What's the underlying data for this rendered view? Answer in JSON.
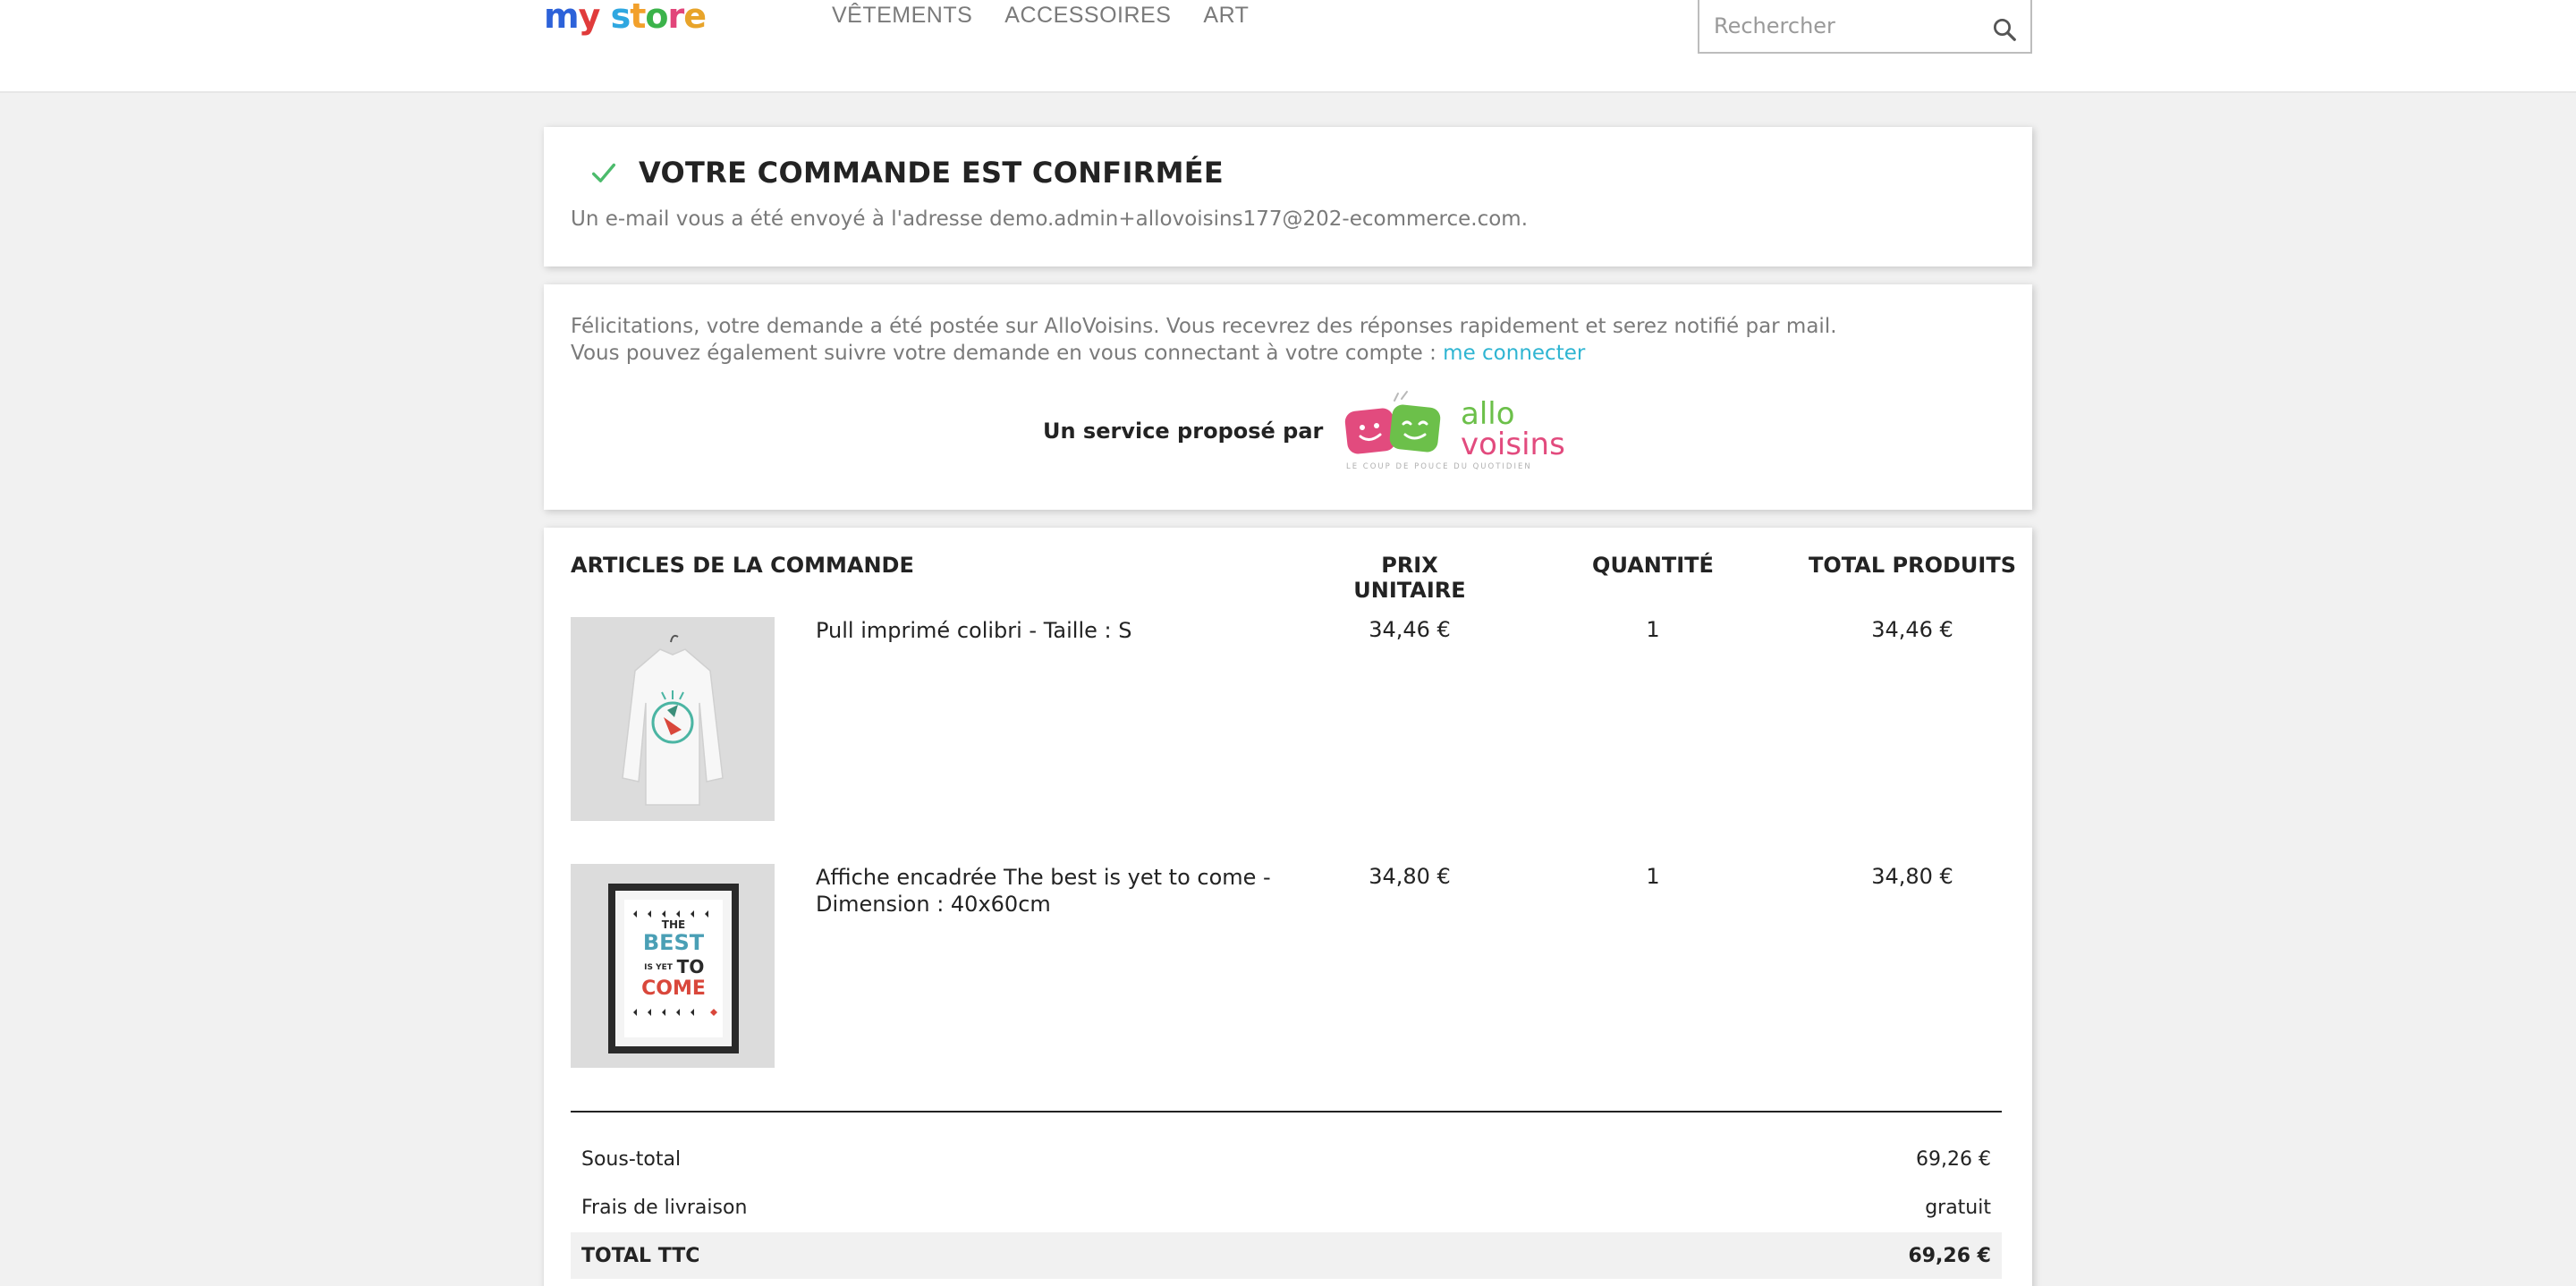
{
  "header": {
    "logo": [
      "m",
      "y",
      " ",
      "s",
      "t",
      "o",
      "r",
      "e"
    ],
    "logo_colors": [
      "#2d62d9",
      "#e03b3b",
      "#ffffff",
      "#2fa7e0",
      "#f2a02b",
      "#3bb34a",
      "#e2457a",
      "#e8a42a"
    ],
    "nav": [
      "VÊTEMENTS",
      "ACCESSOIRES",
      "ART"
    ],
    "search_placeholder": "Rechercher"
  },
  "confirmation": {
    "title": "VOTRE COMMANDE EST CONFIRMÉE",
    "mail_text": "Un e-mail vous a été envoyé à l'adresse demo.admin+allovoisins177@202-ecommerce.com.",
    "check_color": "#4cbb6c"
  },
  "allovoisins": {
    "line1": "Félicitations, votre demande a été postée sur AlloVoisins. Vous recevrez des réponses rapidement et serez notifié par mail.",
    "line2": "Vous pouvez également suivre votre demande en vous connectant à votre compte :",
    "link": "me connecter",
    "service_label": "Un service proposé par",
    "logo_text_1": "allo",
    "logo_text_2": "voisins",
    "tagline": "LE COUP DE POUCE DU QUOTIDIEN",
    "link_color": "#2fb5d2"
  },
  "order": {
    "headers": [
      "ARTICLES DE LA COMMANDE",
      "PRIX UNITAIRE",
      "QUANTITÉ",
      "TOTAL PRODUITS"
    ],
    "items": [
      {
        "name": "Pull imprimé colibri - Taille : S",
        "price": "34,46 €",
        "qty": "1",
        "total": "34,46 €"
      },
      {
        "name": "Affiche encadrée The best is yet to come - Dimension : 40x60cm",
        "price": "34,80 €",
        "qty": "1",
        "total": "34,80 €"
      }
    ],
    "poster_text": [
      "THE",
      "BEST",
      "IS YET",
      "TO",
      "COME"
    ],
    "totals": [
      {
        "label": "Sous-total",
        "value": "69,26 €"
      },
      {
        "label": "Frais de livraison",
        "value": "gratuit"
      },
      {
        "label": "TOTAL TTC",
        "value": "69,26 €"
      }
    ]
  }
}
